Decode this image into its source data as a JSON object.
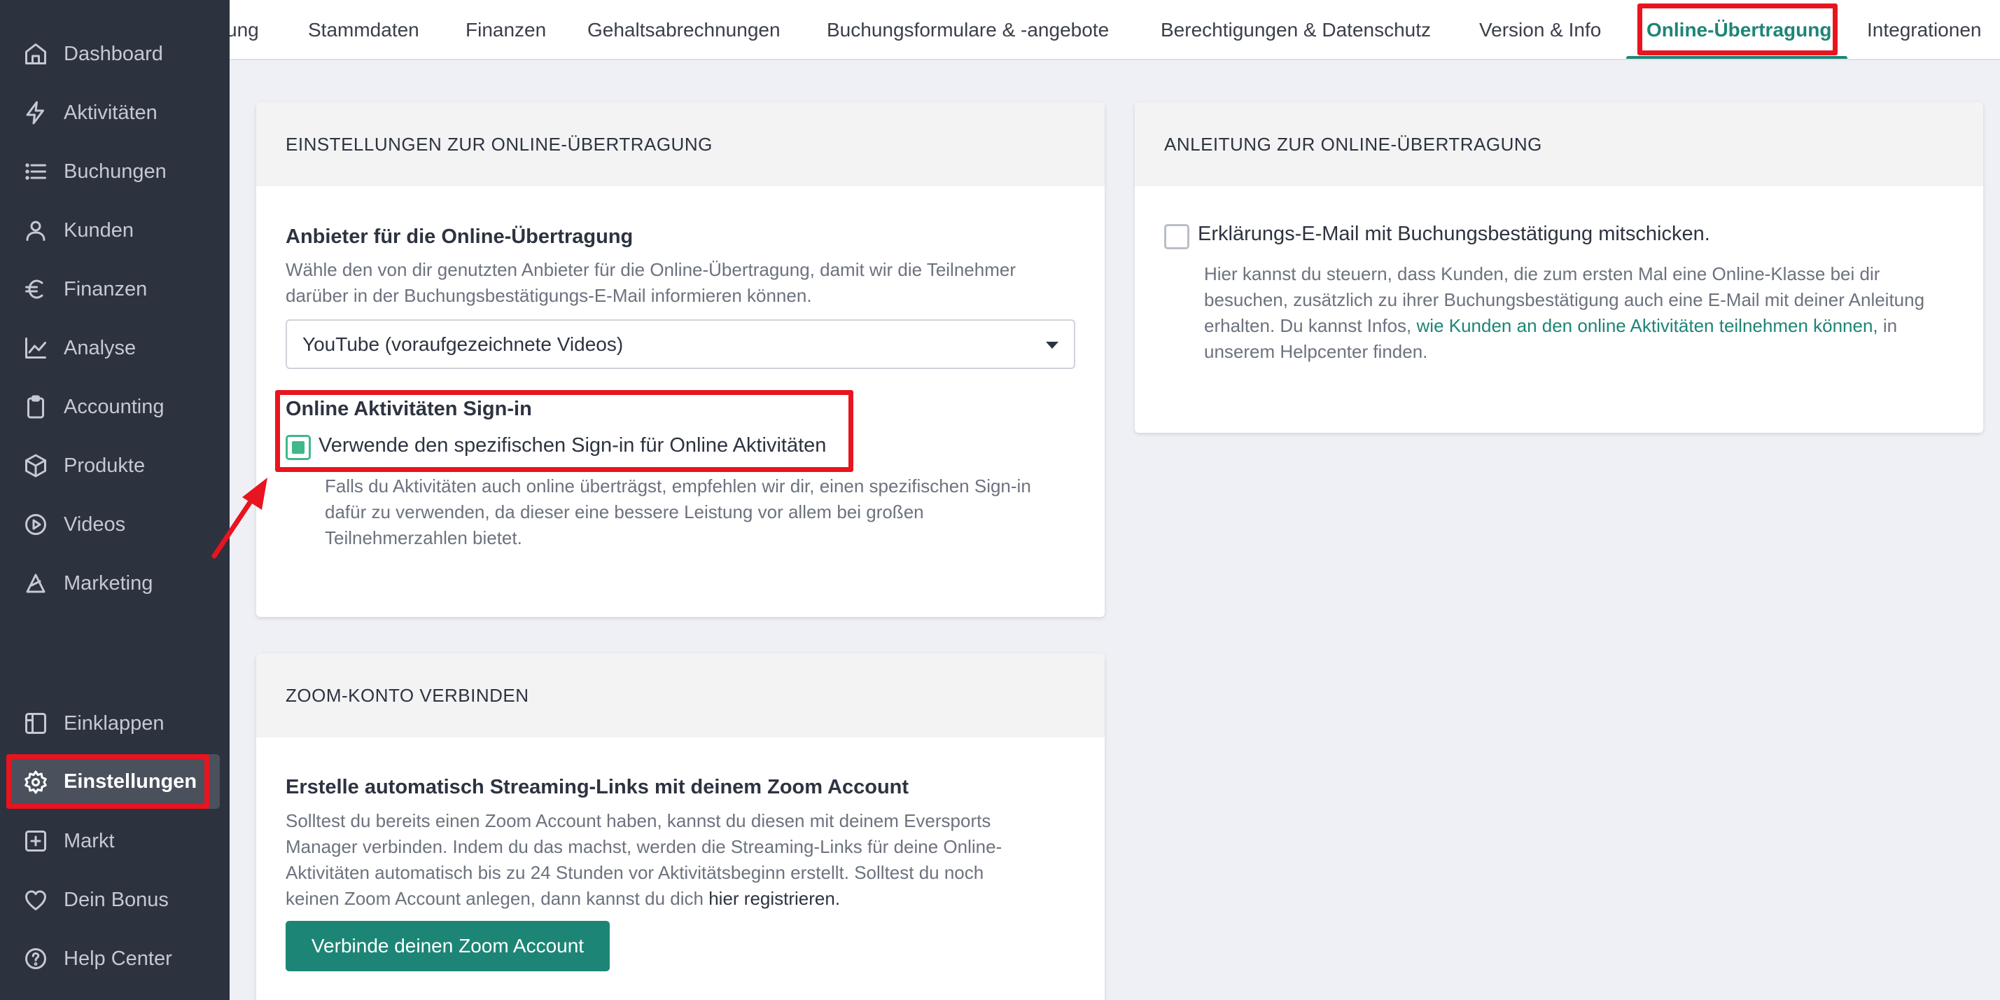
{
  "sidebar": {
    "items": [
      {
        "label": "Dashboard",
        "icon": "home-icon"
      },
      {
        "label": "Aktivitäten",
        "icon": "bolt-icon"
      },
      {
        "label": "Buchungen",
        "icon": "list-icon"
      },
      {
        "label": "Kunden",
        "icon": "user-icon"
      },
      {
        "label": "Finanzen",
        "icon": "euro-icon"
      },
      {
        "label": "Analyse",
        "icon": "chart-line-icon"
      },
      {
        "label": "Accounting",
        "icon": "clipboard-icon"
      },
      {
        "label": "Produkte",
        "icon": "box-icon"
      },
      {
        "label": "Videos",
        "icon": "play-circle-icon"
      },
      {
        "label": "Marketing",
        "icon": "megaphone-icon"
      }
    ],
    "bottom_items": [
      {
        "label": "Einklappen",
        "icon": "collapse-icon"
      },
      {
        "label": "Einstellungen",
        "icon": "gear-icon",
        "active": true
      },
      {
        "label": "Markt",
        "icon": "plus-square-icon"
      },
      {
        "label": "Dein Bonus",
        "icon": "heart-icon"
      },
      {
        "label": "Help Center",
        "icon": "help-circle-icon"
      }
    ]
  },
  "tabs": [
    "ung",
    "Stammdaten",
    "Finanzen",
    "Gehaltsabrechnungen",
    "Buchungsformulare & -angebote",
    "Berechtigungen & Datenschutz",
    "Version & Info",
    "Online-Übertragung",
    "Integrationen"
  ],
  "settings_card": {
    "title": "EINSTELLUNGEN ZUR ONLINE-ÜBERTRAGUNG",
    "provider_label": "Anbieter für die Online-Übertragung",
    "provider_help_1": "Wähle den von dir genutzten Anbieter für die Online-Übertragung, damit wir die Teilnehmer",
    "provider_help_2": "darüber in der Buchungsbestätigungs-E-Mail informieren können.",
    "provider_value": "YouTube (voraufgezeichnete Videos)",
    "signin_label": "Online Aktivitäten Sign-in",
    "signin_checkbox": "Verwende den spezifischen Sign-in für Online Aktivitäten",
    "signin_checked": true,
    "signin_help_1": "Falls du Aktivitäten auch online überträgst, empfehlen wir dir, einen spezifischen Sign-in",
    "signin_help_2": "dafür zu verwenden, da dieser eine bessere Leistung vor allem bei großen",
    "signin_help_3": "Teilnehmerzahlen bietet."
  },
  "guide_card": {
    "title": "ANLEITUNG ZUR ONLINE-ÜBERTRAGUNG",
    "checkbox_label": "Erklärungs-E-Mail mit Buchungsbestätigung mitschicken.",
    "checked": false,
    "help_1": "Hier kannst du steuern, dass Kunden, die zum ersten Mal eine Online-Klasse bei dir",
    "help_2": "besuchen, zusätzlich zu ihrer Buchungsbestätigung auch eine E-Mail mit deiner Anleitung",
    "help_3_pre": "erhalten. Du kannst Infos, ",
    "help_3_link": "wie Kunden an den online Aktivitäten teilnehmen können,",
    "help_3_post": " in",
    "help_4": "unserem Helpcenter finden."
  },
  "zoom_card": {
    "title": "ZOOM-KONTO VERBINDEN",
    "heading": "Erstelle automatisch Streaming-Links mit deinem Zoom Account",
    "help_1": "Solltest du bereits einen Zoom Account haben, kannst du diesen mit deinem Eversports",
    "help_2": "Manager verbinden. Indem du das machst, werden die Streaming-Links für deine Online-",
    "help_3": "Aktivitäten automatisch bis zu 24 Stunden vor Aktivitätsbeginn erstellt. Solltest du noch",
    "help_4_pre": "keinen Zoom Account anlegen, dann kannst du dich ",
    "help_4_link": "hier registrieren.",
    "button": "Verbinde deinen Zoom Account"
  },
  "colors": {
    "accent": "#1d8576",
    "highlight": "#e8141f",
    "sidebar": "#2c323e",
    "checkbox_on": "#3fb88a"
  }
}
